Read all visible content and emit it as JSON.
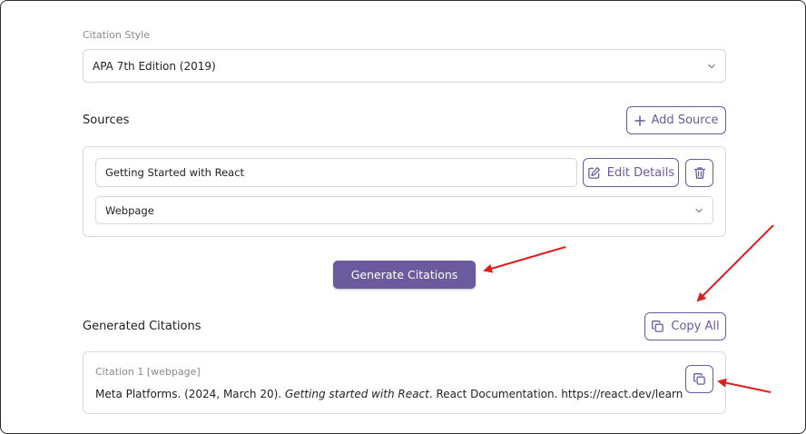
{
  "citation_style": {
    "label": "Citation Style",
    "selected": "APA 7th Edition (2019)"
  },
  "sources": {
    "title": "Sources",
    "add_label": "Add Source",
    "items": [
      {
        "title": "Getting Started with React",
        "edit_label": "Edit Details",
        "type": "Webpage"
      }
    ]
  },
  "generate_label": "Generate Citations",
  "generated": {
    "title": "Generated Citations",
    "copy_all_label": "Copy All",
    "items": [
      {
        "meta": "Citation 1 [webpage]",
        "before": "Meta Platforms. (2024, March 20). ",
        "italic": "Getting started with React",
        "after": ". React Documentation. https://react.dev/learn"
      }
    ]
  },
  "colors": {
    "accent": "#6b5a9e",
    "annotation": "#e01e1e"
  },
  "icons": [
    "chevron-down-icon",
    "plus-icon",
    "edit-icon",
    "trash-icon",
    "copy-icon"
  ]
}
